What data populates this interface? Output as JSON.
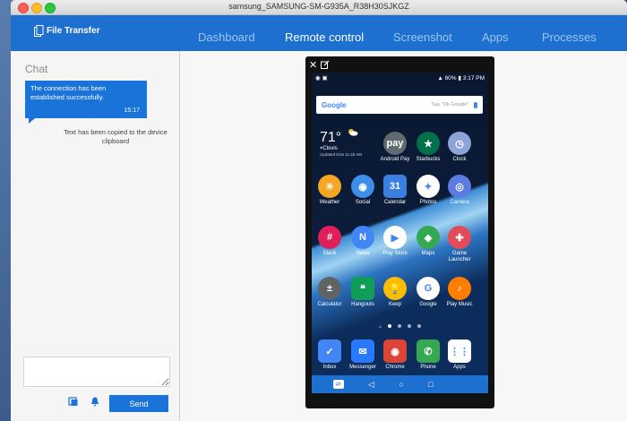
{
  "window": {
    "title": "samsung_SAMSUNG-SM-G935A_R38H30SJKGZ"
  },
  "header": {
    "logo_text": "File Transfer",
    "nav": [
      {
        "label": "Dashboard",
        "active": false
      },
      {
        "label": "Remote control",
        "active": true
      },
      {
        "label": "Screenshot",
        "active": false
      },
      {
        "label": "Apps",
        "active": false
      },
      {
        "label": "Processes",
        "active": false
      }
    ]
  },
  "chat": {
    "title": "Chat",
    "message": {
      "text": "The connection has been established successfully.",
      "time": "15:17"
    },
    "system_message": "Text has been copied to the device clipboard",
    "input_placeholder": "",
    "send_label": "Send"
  },
  "phone": {
    "status_time": "3:17 PM",
    "status_battery": "60%",
    "search_brand": "Google",
    "search_hint": "Say \"Ok Google\"",
    "weather": {
      "temp": "71°",
      "city": "Clovis",
      "updated": "Updated 5/16 11:45 AM"
    },
    "apps": [
      {
        "label": "Android Pay",
        "color": "#5f6b6f",
        "glyph": "pay"
      },
      {
        "label": "Starbucks",
        "color": "#00704a",
        "glyph": "★"
      },
      {
        "label": "Clock",
        "color": "#8fa4d6",
        "glyph": "◷"
      },
      {
        "label": "Weather",
        "color": "#f5a623",
        "glyph": "☀"
      },
      {
        "label": "Social",
        "color": "#3d8ee8",
        "glyph": "◉"
      },
      {
        "label": "Calendar",
        "color": "#3a7fe0",
        "glyph": "31"
      },
      {
        "label": "Photos",
        "color": "#ffffff",
        "glyph": "✦"
      },
      {
        "label": "Camera",
        "color": "#5a7be0",
        "glyph": "◎"
      },
      {
        "label": "Slack",
        "color": "#e01e5a",
        "glyph": "#"
      },
      {
        "label": "News",
        "color": "#4285f4",
        "glyph": "N"
      },
      {
        "label": "Play Store",
        "color": "#ffffff",
        "glyph": "▶"
      },
      {
        "label": "Maps",
        "color": "#34a853",
        "glyph": "◆"
      },
      {
        "label": "Game Launcher",
        "color": "#e24c5a",
        "glyph": "✚"
      },
      {
        "label": "Calculator",
        "color": "#606366",
        "glyph": "±"
      },
      {
        "label": "Hangouts",
        "color": "#0f9d58",
        "glyph": "❝"
      },
      {
        "label": "Keep",
        "color": "#fbbc04",
        "glyph": "💡"
      },
      {
        "label": "Google",
        "color": "#ffffff",
        "glyph": "G"
      },
      {
        "label": "Play Music",
        "color": "#ff7e00",
        "glyph": "♪"
      }
    ],
    "dock": [
      {
        "label": "Inbox",
        "color": "#4285f4",
        "glyph": "✓"
      },
      {
        "label": "Messenger",
        "color": "#2979ff",
        "glyph": "✉"
      },
      {
        "label": "Chrome",
        "color": "#db4437",
        "glyph": "◉"
      },
      {
        "label": "Phone",
        "color": "#34a853",
        "glyph": "✆"
      },
      {
        "label": "Apps",
        "color": "#ffffff",
        "glyph": "⋮⋮"
      }
    ]
  },
  "colors": {
    "accent": "#1d6fd0",
    "bubble": "#1a73d8"
  }
}
